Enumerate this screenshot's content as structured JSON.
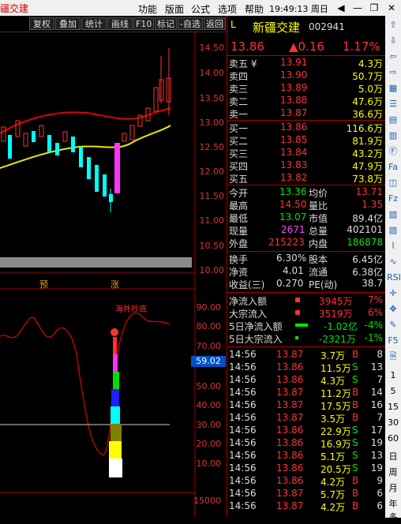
{
  "window": {
    "title": "疆交建",
    "menus": [
      "功能",
      "版面",
      "公式",
      "选项",
      "帮助"
    ],
    "clock": "19:49:13 周日"
  },
  "toolbar": {
    "buttons": [
      "复权",
      "叠加",
      "统计",
      "画线",
      "F10",
      "标记",
      "-自选",
      "返回"
    ]
  },
  "kline": {
    "price_ticks": [
      "14.50",
      "14.00",
      "13.50",
      "13.00",
      "12.50",
      "12.00",
      "11.50",
      "11.00",
      "10.50",
      "10.00"
    ],
    "markers": [
      "预",
      "涨"
    ],
    "colors": {
      "up": "#ff3232",
      "down": "#00ffff",
      "ma_red": "#e00000",
      "ma_yellow": "#e8e800",
      "highlight": "#ff33ff"
    }
  },
  "indicator": {
    "label": "海外抄底",
    "ticks": [
      "90.00",
      "80.00",
      "70.00",
      "59.02",
      "50.00",
      "40.00",
      "30.00",
      "20.00",
      "10.00"
    ],
    "current_value": "59.02"
  },
  "volume": {
    "tick": "15000"
  },
  "stock": {
    "prefix": "L",
    "name": "新疆交建",
    "code": "002941",
    "price": "13.86",
    "change": "▲0.16",
    "change_pct": "1.17%"
  },
  "orderbook": {
    "asks": [
      {
        "label": "卖五 ¥",
        "price": "13.91",
        "vol": "4.3万"
      },
      {
        "label": "卖四",
        "price": "13.90",
        "vol": "50.7万"
      },
      {
        "label": "卖三",
        "price": "13.89",
        "vol": "5.0万"
      },
      {
        "label": "卖二",
        "price": "13.88",
        "vol": "47.6万"
      },
      {
        "label": "卖一",
        "price": "13.87",
        "vol": "36.6万"
      }
    ],
    "bids": [
      {
        "label": "买一",
        "price": "13.86",
        "vol": "116.6万"
      },
      {
        "label": "买二",
        "price": "13.85",
        "vol": "81.9万"
      },
      {
        "label": "买三",
        "price": "13.84",
        "vol": "43.2万"
      },
      {
        "label": "买四",
        "price": "13.83",
        "vol": "47.9万"
      },
      {
        "label": "买五",
        "price": "13.82",
        "vol": "73.8万"
      }
    ]
  },
  "stats": [
    {
      "l1": "今开",
      "v1": "13.36",
      "c1": "green",
      "l2": "均价",
      "v2": "13.71",
      "c2": "red"
    },
    {
      "l1": "最高",
      "v1": "14.50",
      "c1": "red",
      "l2": "量比",
      "v2": "1.35",
      "c2": "red"
    },
    {
      "l1": "最低",
      "v1": "13.07",
      "c1": "green",
      "l2": "市值",
      "v2": "89.4亿",
      "c2": "white"
    },
    {
      "l1": "现量",
      "v1": "2671",
      "c1": "magenta",
      "l2": "总量",
      "v2": "402101",
      "c2": "white"
    },
    {
      "l1": "外盘",
      "v1": "215223",
      "c1": "red",
      "l2": "内盘",
      "v2": "186878",
      "c2": "green"
    }
  ],
  "fundamentals": [
    {
      "l1": "换手",
      "v1": "6.30%",
      "l2": "股本",
      "v2": "6.45亿"
    },
    {
      "l1": "净资",
      "v1": "4.01",
      "l2": "流通",
      "v2": "6.38亿"
    },
    {
      "l1": "收益(三)",
      "v1": "0.270",
      "l2": "PE(动)",
      "v2": "38.7"
    }
  ],
  "flows": [
    {
      "label": "净流入额",
      "value": "3945万",
      "pct": "7%",
      "color": "red"
    },
    {
      "label": "大宗流入",
      "value": "3519万",
      "pct": "6%",
      "color": "red"
    },
    {
      "label": "5日净流入额",
      "value": "-1.02亿",
      "pct": "-4%",
      "color": "green"
    },
    {
      "label": "5日大宗流入",
      "value": "-2321万",
      "pct": "-1%",
      "color": "green"
    }
  ],
  "ticks": [
    {
      "time": "14:56",
      "price": "13.87",
      "vol": "3.7万",
      "side": "B",
      "count": "8"
    },
    {
      "time": "14:56",
      "price": "13.86",
      "vol": "11.5万",
      "side": "S",
      "count": "13"
    },
    {
      "time": "14:56",
      "price": "13.86",
      "vol": "4.3万",
      "side": "S",
      "count": "7"
    },
    {
      "time": "14:56",
      "price": "13.87",
      "vol": "11.2万",
      "side": "B",
      "count": "14"
    },
    {
      "time": "14:56",
      "price": "13.87",
      "vol": "17.5万",
      "side": "B",
      "count": "16"
    },
    {
      "time": "14:56",
      "price": "13.87",
      "vol": "3.5万",
      "side": "B",
      "count": "7"
    },
    {
      "time": "14:56",
      "price": "13.86",
      "vol": "22.9万",
      "side": "S",
      "count": "17"
    },
    {
      "time": "14:56",
      "price": "13.86",
      "vol": "16.9万",
      "side": "S",
      "count": "19"
    },
    {
      "time": "14:56",
      "price": "13.86",
      "vol": "5.1万",
      "side": "S",
      "count": "13"
    },
    {
      "time": "14:56",
      "price": "13.86",
      "vol": "20.5万",
      "side": "S",
      "count": "19"
    },
    {
      "time": "14:56",
      "price": "13.86",
      "vol": "4.2万",
      "side": "B",
      "count": "9"
    },
    {
      "time": "14:56",
      "price": "13.87",
      "vol": "5.7万",
      "side": "B",
      "count": "6"
    },
    {
      "time": "14:56",
      "price": "13.87",
      "vol": "4.2万",
      "side": "B",
      "count": "6"
    }
  ],
  "side_tabs": [
    "1",
    "5",
    "15",
    "30",
    "60",
    "日",
    "周",
    "月",
    "年",
    "多"
  ]
}
